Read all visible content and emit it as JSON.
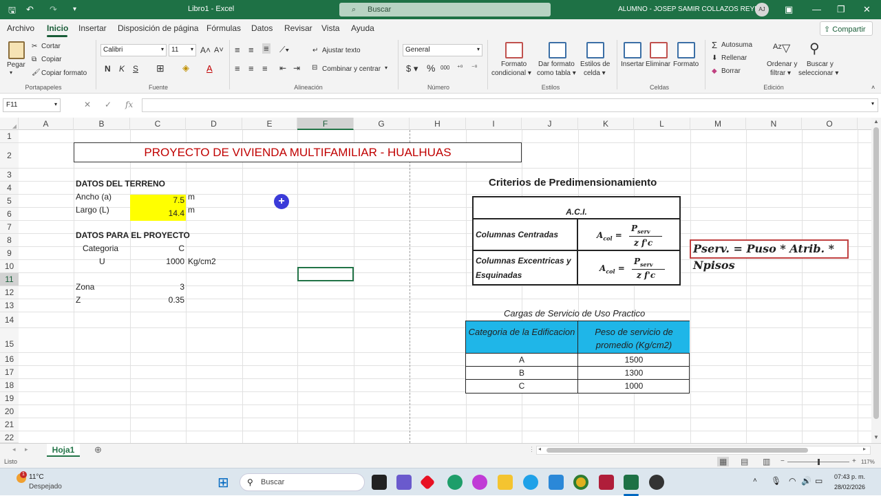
{
  "titlebar": {
    "doc_title": "Libro1  -  Excel",
    "search_placeholder": "Buscar",
    "user": "ALUMNO - JOSEP SAMIR COLLAZOS REYES",
    "avatar": "AJ"
  },
  "menu": {
    "tabs": [
      "Archivo",
      "Inicio",
      "Insertar",
      "Disposición de página",
      "Fórmulas",
      "Datos",
      "Revisar",
      "Vista",
      "Ayuda"
    ],
    "active": "Inicio",
    "share": "Compartir"
  },
  "ribbon": {
    "portapapeles": {
      "paste": "Pegar",
      "cut": "Cortar",
      "copy": "Copiar",
      "format_painter": "Copiar formato",
      "label": "Portapapeles"
    },
    "fuente": {
      "font": "Calibri",
      "size": "11",
      "label": "Fuente",
      "bold": "N",
      "italic": "K",
      "underline": "S"
    },
    "alineacion": {
      "wrap": "Ajustar texto",
      "merge": "Combinar y centrar",
      "label": "Alineación"
    },
    "numero": {
      "format": "General",
      "label": "Número"
    },
    "estilos": {
      "cond_format": "Formato condicional",
      "table_format": "Dar formato como tabla",
      "cell_styles": "Estilos de celda",
      "label": "Estilos"
    },
    "celdas": {
      "insert": "Insertar",
      "delete": "Eliminar",
      "format": "Formato",
      "label": "Celdas"
    },
    "edicion": {
      "autosum": "Autosuma",
      "fill": "Rellenar",
      "clear": "Borrar",
      "sort": "Ordenar y filtrar",
      "find": "Buscar y seleccionar",
      "label": "Edición"
    }
  },
  "formula_bar": {
    "name_box": "F11",
    "fx": "fx",
    "content": ""
  },
  "columns": [
    "A",
    "B",
    "C",
    "D",
    "E",
    "F",
    "G",
    "H",
    "I",
    "J",
    "K",
    "L",
    "M",
    "N",
    "O"
  ],
  "selected_column": "F",
  "rows": [
    "1",
    "2",
    "3",
    "4",
    "5",
    "6",
    "7",
    "8",
    "9",
    "10",
    "11",
    "12",
    "13",
    "14",
    "15",
    "16",
    "17",
    "18",
    "19",
    "20",
    "21",
    "22"
  ],
  "selected_row": "11",
  "sheet": {
    "title": "PROYECTO DE VIVIENDA MULTIFAMILIAR - HUALHUAS",
    "terreno_header": "DATOS DEL TERRENO",
    "ancho_label": "Ancho (a)",
    "ancho_value": "7.5",
    "ancho_unit": "m",
    "largo_label": "Largo (L)",
    "largo_value": "14.4",
    "largo_unit": "m",
    "proyecto_header": "DATOS PARA EL PROYECTO",
    "categoria_label": "Categoria",
    "categoria_value": "C",
    "u_label": "U",
    "u_value": "1000",
    "u_unit": "Kg/cm2",
    "zona_label": "Zona",
    "zona_value": "3",
    "z_label": "Z",
    "z_value": "0.35"
  },
  "criteria": {
    "title": "Criterios de Predimensionamiento",
    "header": "A.C.I.",
    "row1_label": "Columnas Centradas",
    "row2_label_1": "Columnas Excentricas y",
    "row2_label_2": "Esquinadas",
    "formula_lhs": "A",
    "formula_lhs_sub": "col",
    "formula_num": "P",
    "formula_num_sub": "serv",
    "formula_den": "z   f'c",
    "pserv_formula": "Pserv. = Puso * Atrib. * Npisos"
  },
  "loads": {
    "title": "Cargas de Servicio de Uso Practico",
    "col1_header": "Categoria de la Edificacion",
    "col2_header": "Peso de servicio de promedio (Kg/cm2)",
    "rows": [
      {
        "cat": "A",
        "val": "1500"
      },
      {
        "cat": "B",
        "val": "1300"
      },
      {
        "cat": "C",
        "val": "1000"
      }
    ]
  },
  "sheet_tab": "Hoja1",
  "status": {
    "text": "Listo",
    "zoom": "117%"
  },
  "taskbar": {
    "temp": "11°C",
    "weather": "Despejado",
    "search": "Buscar",
    "time": "07:43 p. m.",
    "date": "28/02/2026"
  },
  "colors": {
    "excel_green": "#1e7145",
    "accent": "#185c37",
    "title_red": "#c00000",
    "highlight": "#ffff00",
    "table_header": "#1fb6e8"
  }
}
